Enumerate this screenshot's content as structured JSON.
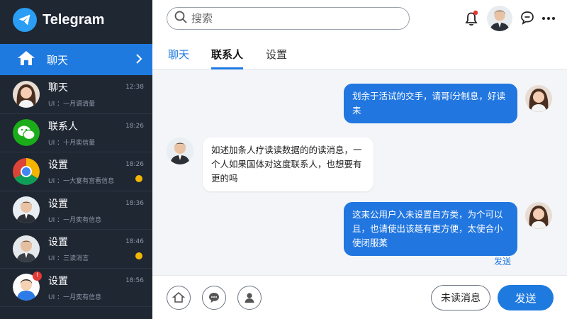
{
  "app": {
    "name": "Telegram",
    "logo_icon": "paper-plane-icon",
    "accent": "#1f7ae0"
  },
  "sidebar": {
    "active_nav": {
      "label": "聊天",
      "icon": "home-icon"
    },
    "chats": [
      {
        "name": "聊天",
        "preview": "UI ：一月调清量",
        "time": "12:38",
        "avatar": "woman-avatar",
        "dot": false,
        "badge": ""
      },
      {
        "name": "联系人",
        "preview": "UI ：十月奕信量",
        "time": "18:26",
        "avatar": "wechat-logo",
        "dot": false,
        "badge": ""
      },
      {
        "name": "设置",
        "preview": "UI ：一大宴有宫看信息",
        "time": "18:26",
        "avatar": "chrome-logo",
        "dot": true,
        "badge": ""
      },
      {
        "name": "设置",
        "preview": "UI ：一月奕有信息",
        "time": "18:36",
        "avatar": "man-avatar",
        "dot": false,
        "badge": ""
      },
      {
        "name": "设置",
        "preview": "UI ：三读消言",
        "time": "18:46",
        "avatar": "man-avatar-2",
        "dot": true,
        "badge": ""
      },
      {
        "name": "设置",
        "preview": "UI ：一月奕有信息",
        "time": "18:56",
        "avatar": "cartoon-avatar",
        "dot": false,
        "badge": "!"
      }
    ]
  },
  "search": {
    "placeholder": "搜索"
  },
  "tabs": [
    {
      "label": "聊天",
      "state": "blue"
    },
    {
      "label": "联系人",
      "state": "active"
    },
    {
      "label": "设置",
      "state": "normal"
    }
  ],
  "messages": [
    {
      "direction": "out",
      "text": "划余于活试的交手，请哥í分制息，好读耒"
    },
    {
      "direction": "in",
      "text": "如述加条人疗读读数据的的读消息，一个人如果国体对这度联系人，也想要有更的吗"
    },
    {
      "direction": "out",
      "text": "这耒公用户入未设置自方类，为个可以且，也请使出该趆有更方便，太使合小使闭服葇"
    }
  ],
  "sent_status": "发送",
  "bottom": {
    "unread_label": "未读消息",
    "send_label": "发送"
  }
}
